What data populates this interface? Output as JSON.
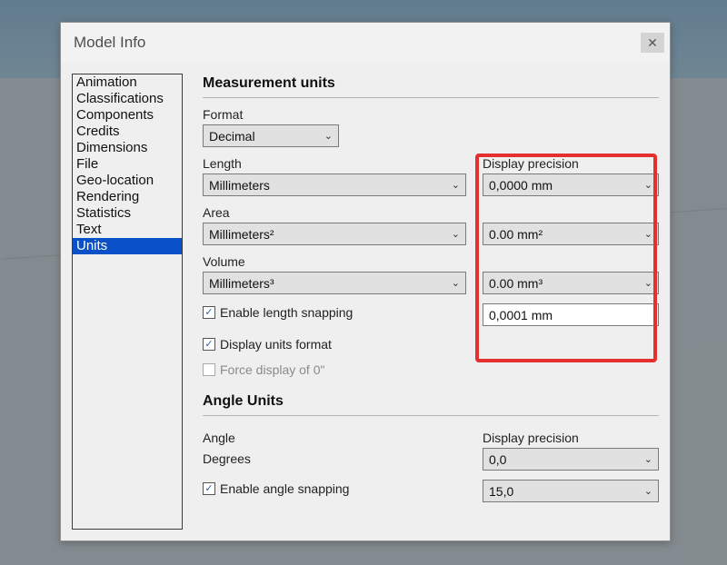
{
  "dialog": {
    "title": "Model Info"
  },
  "sidebar": {
    "items": [
      "Animation",
      "Classifications",
      "Components",
      "Credits",
      "Dimensions",
      "File",
      "Geo-location",
      "Rendering",
      "Statistics",
      "Text",
      "Units"
    ],
    "selected": "Units"
  },
  "sections": {
    "measurement": {
      "heading": "Measurement units",
      "format_label": "Format",
      "format_value": "Decimal",
      "display_precision_label": "Display precision",
      "length_label": "Length",
      "length_value": "Millimeters",
      "length_precision": "0,0000 mm",
      "area_label": "Area",
      "area_value": "Millimeters²",
      "area_precision": "0.00 mm²",
      "volume_label": "Volume",
      "volume_value": "Millimeters³",
      "volume_precision": "0.00 mm³",
      "enable_length_snapping": "Enable length snapping",
      "length_snap_value": "0,0001 mm",
      "display_units_format": "Display units format",
      "force_display": "Force display of 0\""
    },
    "angle": {
      "heading": "Angle Units",
      "angle_label": "Angle",
      "angle_precision_label": "Display precision",
      "angle_value": "Degrees",
      "angle_precision": "0,0",
      "enable_angle_snapping": "Enable angle snapping",
      "angle_snap_value": "15,0"
    }
  }
}
